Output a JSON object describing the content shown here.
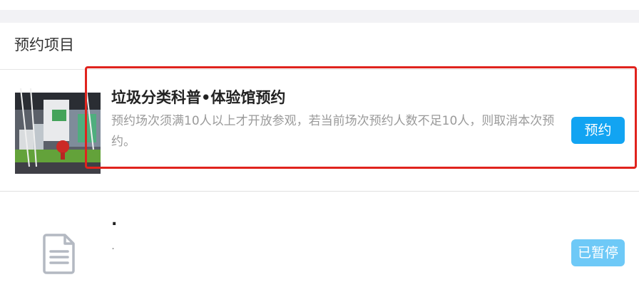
{
  "section": {
    "title": "预约项目"
  },
  "items": [
    {
      "title": "垃圾分类科普•体验馆预约",
      "description": "预约场次须满10人以上才开放参观，若当前场次预约人数不足10人，则取消本次预约。",
      "action_label": "预约",
      "action_color": "#12a4f2"
    },
    {
      "title": ".",
      "description": ".",
      "action_label": "已暂停",
      "action_color": "#6ec9f7",
      "icon": "document-list-icon"
    }
  ],
  "colors": {
    "accent": "#12a4f2",
    "highlight": "#e0231d",
    "strip": "#f2f2f5"
  }
}
